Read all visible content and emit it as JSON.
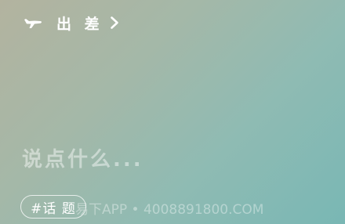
{
  "header": {
    "icon": "airplane-icon",
    "title": "出 差",
    "chevron_icon": "chevron-right-icon"
  },
  "composer": {
    "placeholder": "说点什么..."
  },
  "topic_tag": {
    "label": "#话 题"
  },
  "watermark": {
    "text": "易下APP • 4008891800.COM"
  },
  "colors": {
    "gradient_start": "#b3b39f",
    "gradient_end": "#79b7b4",
    "text": "#ffffff"
  }
}
